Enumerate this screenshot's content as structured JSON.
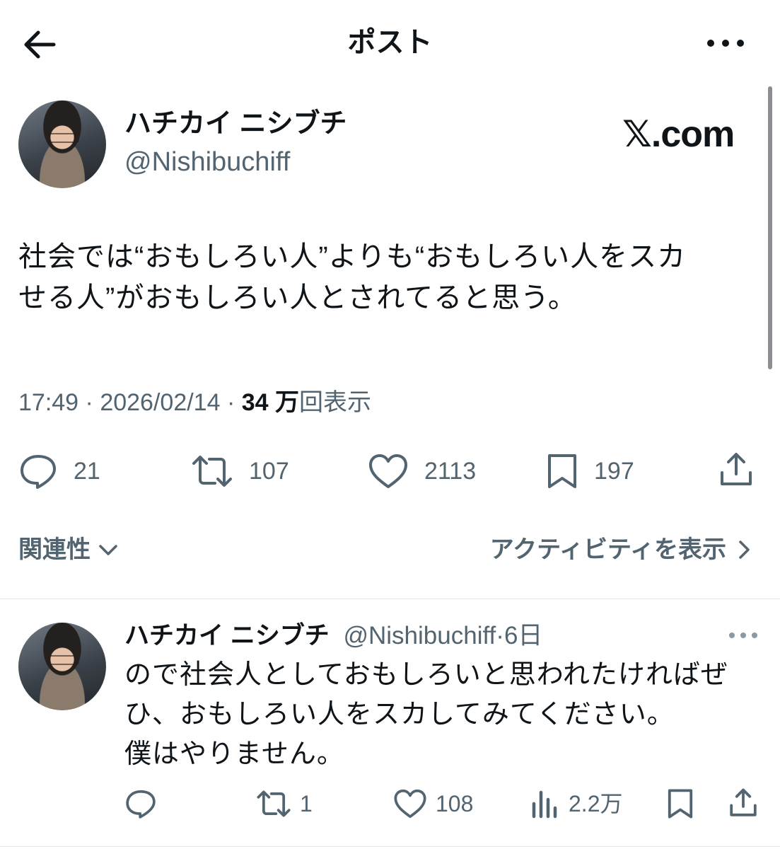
{
  "header": {
    "title": "ポスト",
    "back_icon": "arrow-left-icon",
    "more_icon": "more-horizontal-icon"
  },
  "post": {
    "display_name": "ハチカイ ニシブチ",
    "handle": "@Nishibuchiff",
    "watermark": "𝕏.com",
    "text_line1": "社会では“おもしろい人”よりも“おもしろい人をスカ",
    "text_line2": "せる人”がおもしろい人とされてると思う。",
    "time": "17:49",
    "date": "2026/02/14",
    "views_count": "34 万",
    "views_label": "回表示",
    "separator": "·",
    "actions": {
      "reply_count": "21",
      "repost_count": "107",
      "like_count": "2113",
      "bookmark_count": "197"
    }
  },
  "related": {
    "label": "関連性",
    "activity_label": "アクティビティを表示"
  },
  "reply": {
    "display_name": "ハチカイ ニシブチ",
    "handle": "@Nishibuchiff",
    "separator": "·",
    "age": "6日",
    "text_line1": "ので社会人としておもしろいと思われたければぜ",
    "text_line2": "ひ、おもしろい人をスカしてみてください。",
    "text_line3": "僕はやりません。",
    "actions": {
      "repost_count": "1",
      "like_count": "108",
      "views_count": "2.2万"
    }
  },
  "colors": {
    "text": "#0f1419",
    "secondary": "#536471",
    "divider": "#e4e8eb",
    "background": "#ffffff"
  }
}
